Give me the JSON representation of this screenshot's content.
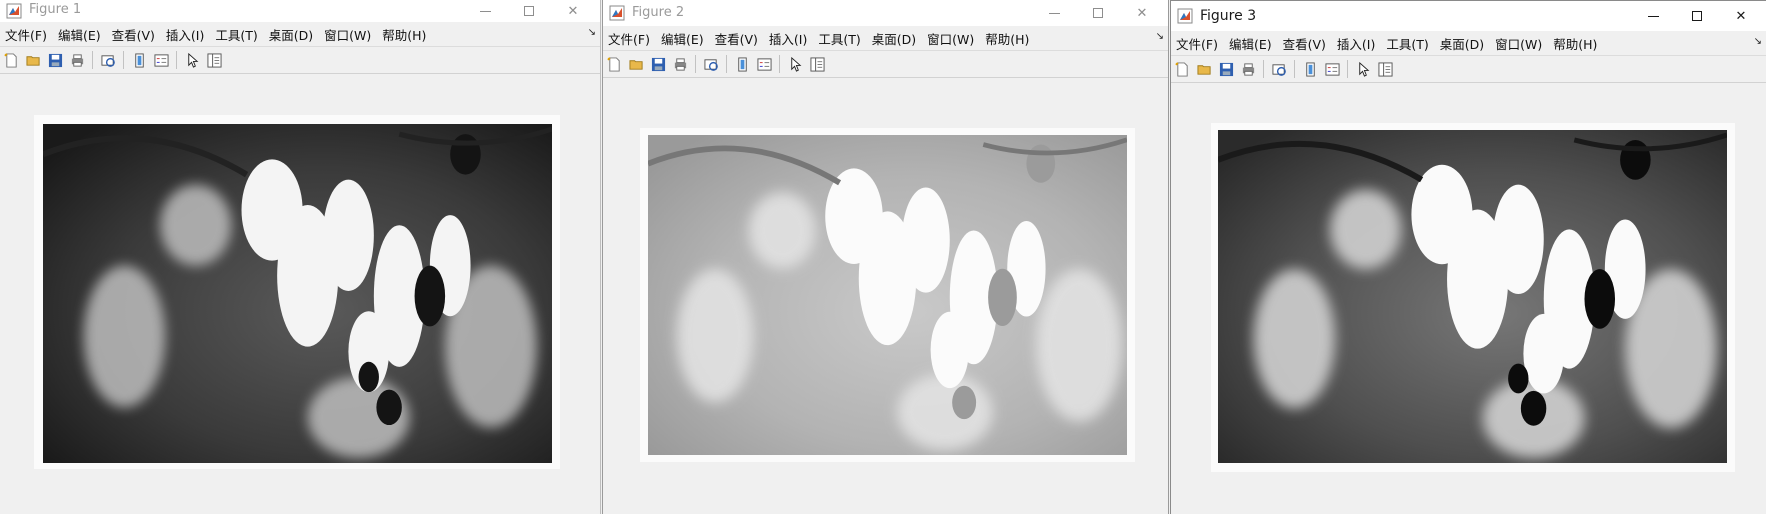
{
  "figures": [
    {
      "id": "figure-1",
      "title": "Figure 1",
      "active": false,
      "menu": [
        "文件(F)",
        "编辑(E)",
        "查看(V)",
        "插入(I)",
        "工具(T)",
        "桌面(D)",
        "窗口(W)",
        "帮助(H)"
      ],
      "image_variant": "high-contrast"
    },
    {
      "id": "figure-2",
      "title": "Figure 2",
      "active": false,
      "menu": [
        "文件(F)",
        "编辑(E)",
        "查看(V)",
        "插入(I)",
        "工具(T)",
        "桌面(D)",
        "窗口(W)",
        "帮助(H)"
      ],
      "image_variant": "washed-out"
    },
    {
      "id": "figure-3",
      "title": "Figure 3",
      "active": true,
      "menu": [
        "文件(F)",
        "编辑(E)",
        "查看(V)",
        "插入(I)",
        "工具(T)",
        "桌面(D)",
        "窗口(W)",
        "帮助(H)"
      ],
      "image_variant": "equalized"
    }
  ],
  "toolbar_icons": [
    "new-figure-icon",
    "open-file-icon",
    "save-icon",
    "print-icon",
    "link-plot-icon",
    "colorbar-icon",
    "legend-icon",
    "edit-plot-arrow-icon",
    "property-inspector-icon"
  ],
  "colors": {
    "titlebar_bg": "#ffffff",
    "window_bg": "#f0f0f0",
    "title_inactive": "#9a9a9a",
    "title_active": "#1a1a1a"
  }
}
